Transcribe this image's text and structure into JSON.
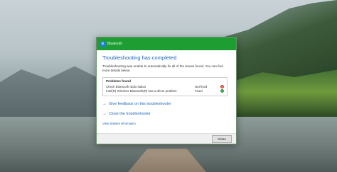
{
  "dialog": {
    "window_title": "Bluetooth",
    "bt_icon_glyph": "ʙ",
    "heading": "Troubleshooting has completed",
    "description": "Troubleshooting was unable to automatically fix all of the issues found. You can find more details below.",
    "problems": {
      "title": "Problems found",
      "rows": [
        {
          "name": "Check Bluetooth radio status",
          "status": "Not fixed",
          "icon": "error-icon"
        },
        {
          "name": "Intel(R) Wireless Bluetooth(R) has a driver problem",
          "status": "Fixed",
          "icon": "check-icon"
        }
      ]
    },
    "links": {
      "feedback": "Give feedback on this troubleshooter",
      "close_troubleshooter": "Close the troubleshooter",
      "view_details": "View detailed information"
    },
    "close_button": "Close"
  },
  "colors": {
    "titlebar": "#1e9e32",
    "link": "#1b63b8",
    "error": "#d9342b",
    "success": "#2e9b3a"
  }
}
